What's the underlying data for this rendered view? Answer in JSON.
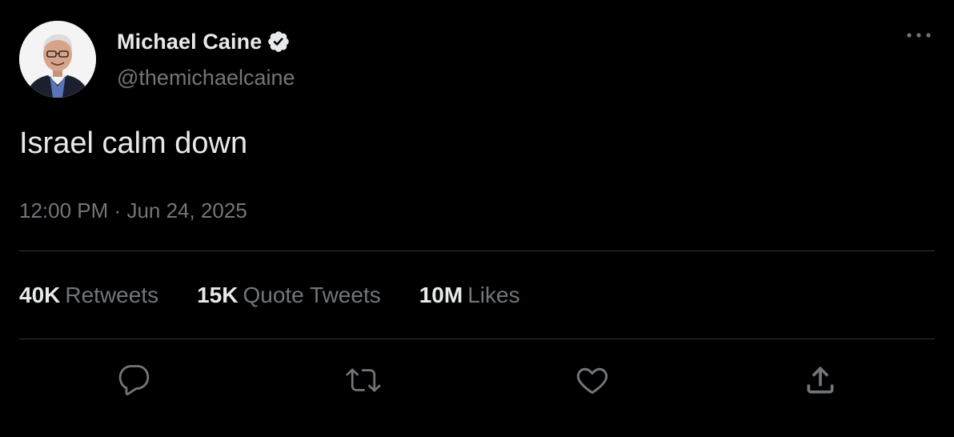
{
  "author": {
    "display_name": "Michael Caine",
    "handle": "@themichaelcaine",
    "verified": true,
    "avatar_icon": "profile-photo"
  },
  "tweet": {
    "text": "Israel calm down",
    "time": "12:00 PM",
    "separator": "·",
    "date": "Jun 24, 2025"
  },
  "stats": [
    {
      "count": "40K",
      "label": "Retweets"
    },
    {
      "count": "15K",
      "label": "Quote Tweets"
    },
    {
      "count": "10M",
      "label": "Likes"
    }
  ],
  "actions": [
    {
      "icon": "reply-icon"
    },
    {
      "icon": "retweet-icon"
    },
    {
      "icon": "like-icon"
    },
    {
      "icon": "share-icon"
    }
  ],
  "menu_icon": "more-options-icon",
  "colors": {
    "background": "#000000",
    "primary_text": "#e7e9ea",
    "secondary_text": "#71767b",
    "divider": "#2f3336",
    "verified_badge": "#e7e9ea"
  }
}
